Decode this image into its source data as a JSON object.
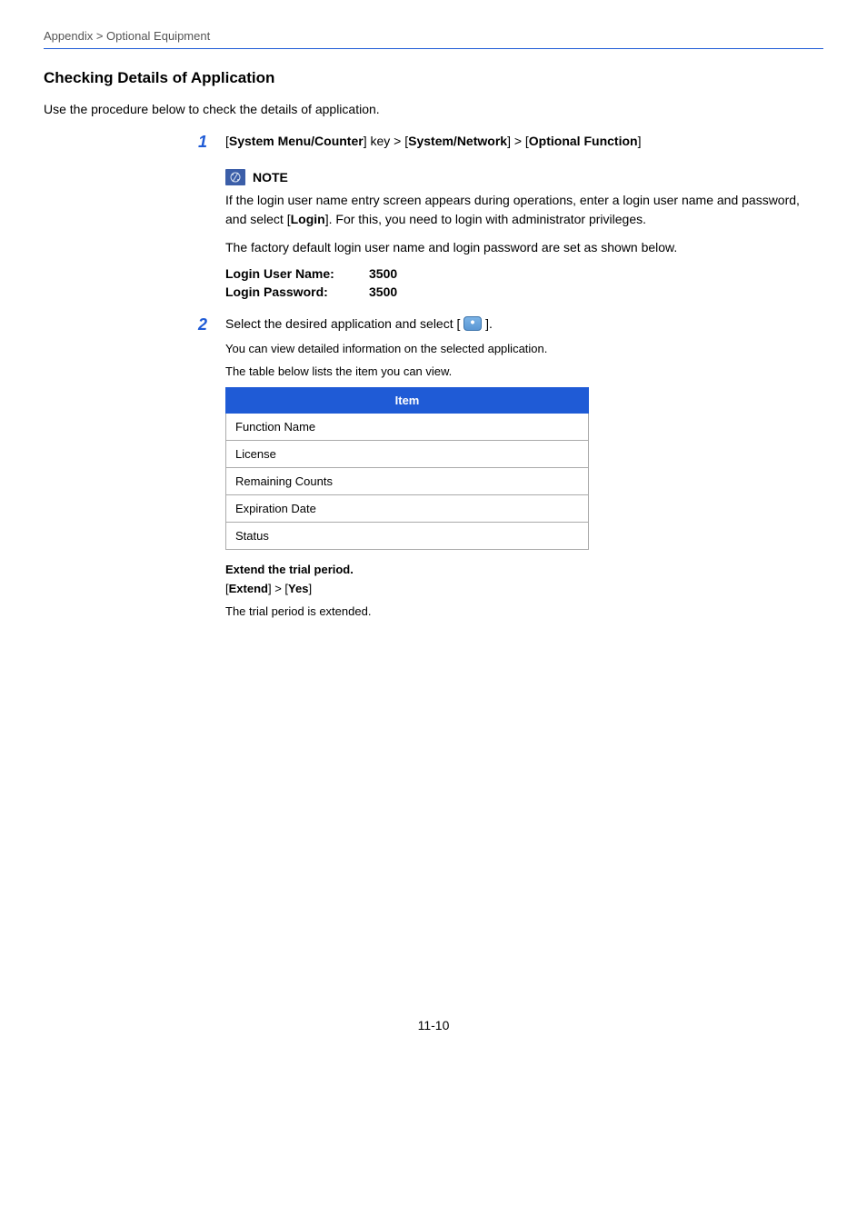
{
  "breadcrumb": "Appendix > Optional Equipment",
  "title": "Checking Details of Application",
  "intro": "Use the procedure below to check the details of application.",
  "step1": {
    "prefix": "[",
    "k1": "System Menu/Counter",
    "mid1": "] key > [",
    "k2": "System/Network",
    "mid2": "] > [",
    "k3": "Optional Function",
    "suffix": "]"
  },
  "note": {
    "label": "NOTE",
    "p1a": "If the login user name entry screen appears during operations, enter a login user name and password, and select [",
    "p1b": "Login",
    "p1c": "]. For this, you need to login with administrator privileges.",
    "p2": "The factory default login user name and login password are set as shown below.",
    "user_label": "Login User Name:",
    "user_value": "3500",
    "pass_label": "Login Password:",
    "pass_value": "3500"
  },
  "step2": {
    "line_a": "Select the desired application and select [",
    "line_b": "].",
    "sub1": "You can view detailed information on the selected application.",
    "sub2": "The table below lists the item you can view."
  },
  "table": {
    "header": "Item",
    "rows": [
      "Function Name",
      "License",
      "Remaining Counts",
      "Expiration Date",
      "Status"
    ]
  },
  "extend": {
    "heading": "Extend the trial period.",
    "path_a": "[",
    "path_k1": "Extend",
    "path_mid": "] > [",
    "path_k2": "Yes",
    "path_end": "]",
    "result": "The trial period is extended."
  },
  "page_number": "11-10"
}
